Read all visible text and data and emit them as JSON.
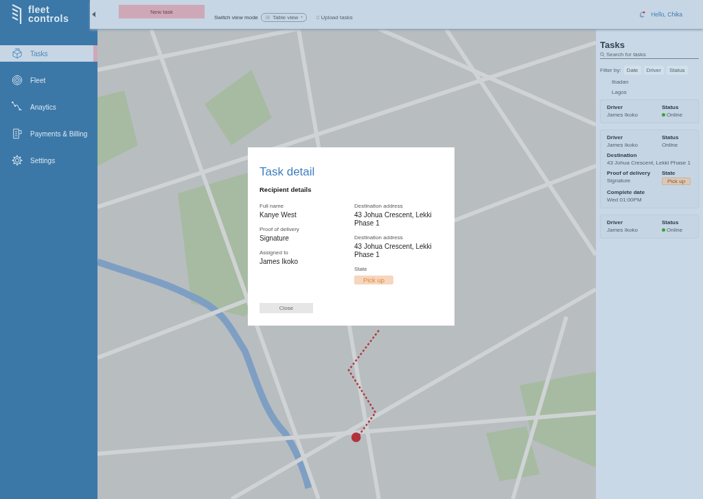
{
  "brand": {
    "logo_lines": [
      "fleet",
      "controls"
    ]
  },
  "nav": [
    {
      "label": "Tasks",
      "selected": true
    },
    {
      "label": "Fleet",
      "selected": false
    },
    {
      "label": "Anaytics",
      "selected": false
    },
    {
      "label": "Payments & Billing",
      "selected": false
    },
    {
      "label": "Settings",
      "selected": false
    }
  ],
  "topbar": {
    "new_task_button": "New task",
    "view_mode_label": "Switch view mode",
    "view_mode_value": "Table view",
    "upload_link": "Upload tasks",
    "notification_unread": true,
    "greeting": "Hello, Chika"
  },
  "tasks_panel": {
    "title": "Tasks",
    "search": {
      "placeholder": "Search for tasks"
    },
    "filter_label": "Filter by:",
    "filters": [
      "Date",
      "Driver",
      "Status"
    ],
    "locations": [
      "Ibadan",
      "Lagos"
    ],
    "cards": [
      {
        "fields": [
          {
            "label": "Driver",
            "value": "James Ikoko",
            "kind": "text"
          },
          {
            "label": "Status",
            "value": "Online",
            "kind": "status",
            "online": true
          }
        ]
      },
      {
        "fields": [
          {
            "label": "Driver",
            "value": "James Ikoko",
            "kind": "text"
          },
          {
            "label": "Status",
            "value": "Online",
            "kind": "status",
            "online": false
          },
          {
            "label": "Destination",
            "value": "43 Johua Crescent, Lekki Phase 1",
            "kind": "wide"
          },
          {
            "label": "Proof of delivery",
            "value": "Signature",
            "kind": "text"
          },
          {
            "label": "State",
            "value": "Pick up",
            "kind": "badge"
          },
          {
            "label": "Complete date",
            "value": "Wed 01:00PM",
            "kind": "text"
          }
        ]
      },
      {
        "fields": [
          {
            "label": "Driver",
            "value": "James Ikoko",
            "kind": "text"
          },
          {
            "label": "Status",
            "value": "Online",
            "kind": "status",
            "online": true
          }
        ]
      }
    ]
  },
  "task_detail": {
    "title": "Task detail",
    "subtitle": "Recipient details",
    "left": [
      {
        "label": "Full name",
        "value": "Kanye West",
        "kind": "text"
      },
      {
        "label": "Proof of delivery",
        "value": "Signature",
        "kind": "text"
      },
      {
        "label": "Assigned to",
        "value": "James Ikoko",
        "kind": "text"
      }
    ],
    "right": [
      {
        "label": "Destination address",
        "value": "43 Johua Crescent, Lekki Phase 1",
        "kind": "text"
      },
      {
        "label": "Destination address",
        "value": "43 Johua Crescent, Lekki Phase 1",
        "kind": "text"
      },
      {
        "label": "State",
        "value": "Pick up",
        "kind": "badge"
      }
    ],
    "close_button": "Close"
  }
}
